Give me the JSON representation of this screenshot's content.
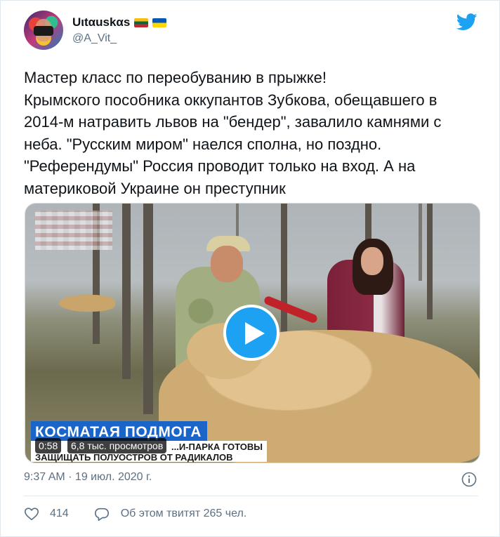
{
  "author": {
    "display_name": "Uιtαuskαs",
    "handle": "@A_Vit_",
    "flags": [
      "flag-lithuania",
      "flag-ukraine"
    ]
  },
  "tweet": {
    "text": "Мастер класс по переобуванию в прыжке!\nКрымского пособника оккупантов Зубкова, обещавшего в 2014-м натравить львов на \"бендер\", завалило камнями с неба. \"Русским миром\" наелся сполна, но поздно. \"Референдумы\" Россия проводит только на вход. А на материковой Украине он преступник"
  },
  "video": {
    "banner_text": "КОСМАТАЯ ПОДМОГА",
    "caption_line1": "...И-ПАРКА ГОТОВЫ",
    "caption_line2": "ЗАЩИЩАТЬ ПОЛУОСТРОВ ОТ РАДИКАЛОВ",
    "duration": "0:58",
    "views": "6,8 тыс. просмотров",
    "play_icon": "play-icon"
  },
  "footer": {
    "timestamp": "9:37 AM · 19 июл. 2020 г.",
    "like_count": "414",
    "reply_text": "Об этом твитят 265 чел."
  },
  "colors": {
    "brand": "#1da1f2",
    "secondary_text": "#5b7083",
    "banner": "#1b64c8"
  }
}
